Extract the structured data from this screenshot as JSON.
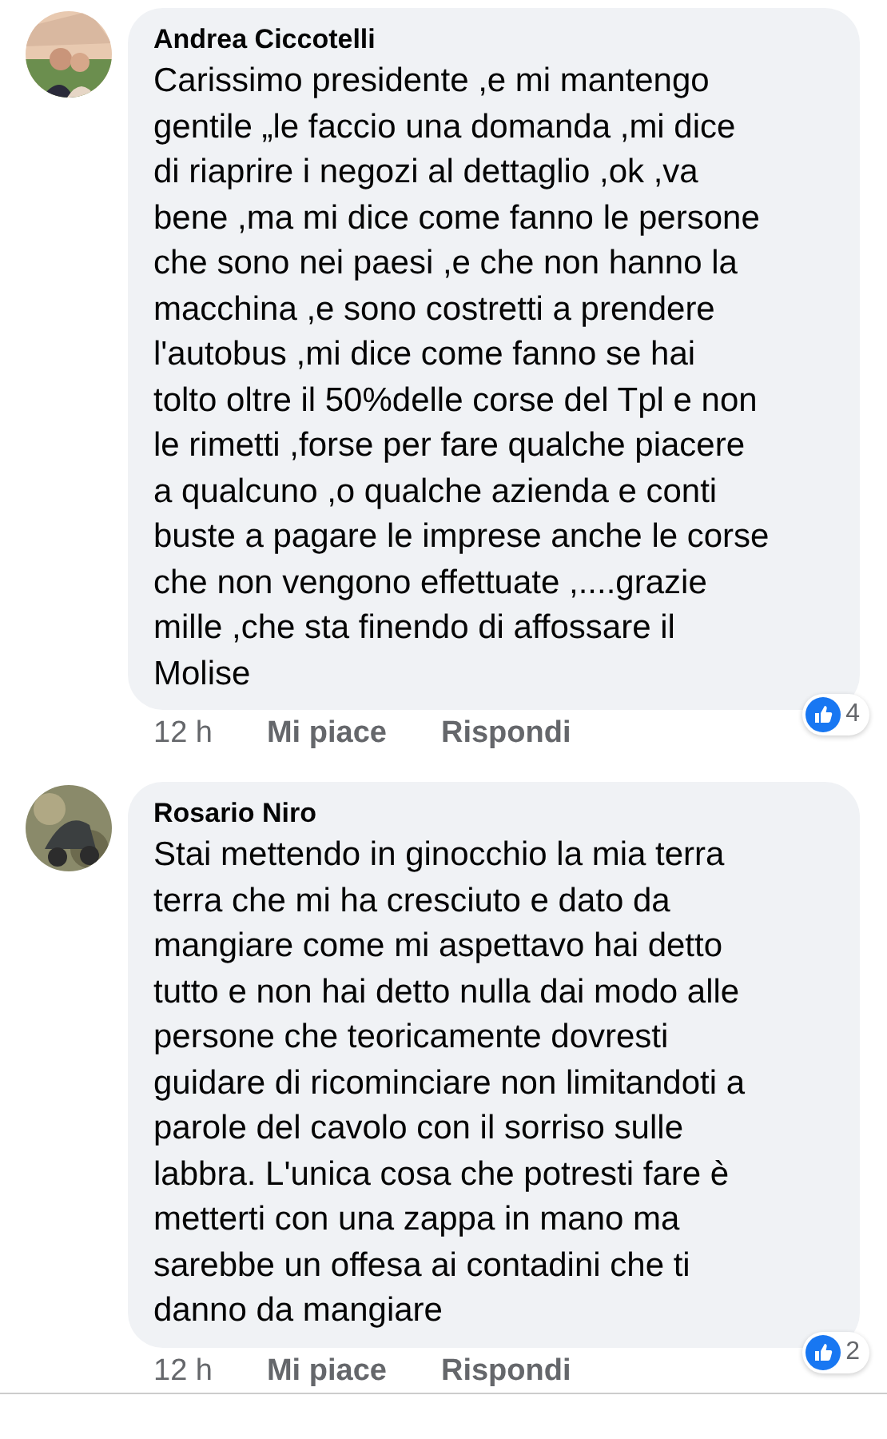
{
  "comments": [
    {
      "author": "Andrea Ciccotelli",
      "text": "Carissimo presidente ,e mi mantengo\ngentile „le faccio una domanda ,mi dice\ndi riaprire i negozi al dettaglio ,ok ,va\nbene ,ma mi dice come fanno le persone\nche sono nei paesi ,e che non hanno la\nmacchina ,e sono costretti a prendere\nl'autobus ,mi dice come fanno se hai\ntolto oltre il 50%delle corse del Tpl e non\nle rimetti ,forse per fare qualche piacere\na qualcuno ,o qualche azienda e conti\nbuste a pagare le imprese anche le corse\nche non vengono effettuate ,....grazie\nmille ,che sta finendo di affossare il\nMolise",
      "time": "12 h",
      "like": "Mi piace",
      "reply": "Rispondi",
      "reactions": "4"
    },
    {
      "author": "Rosario Niro",
      "text": "Stai mettendo in ginocchio la mia terra\nterra che mi ha cresciuto e dato da\nmangiare come mi aspettavo hai detto\ntutto e non hai detto nulla dai modo alle\npersone che teoricamente dovresti\nguidare di ricominciare non limitandoti a\nparole del cavolo con il sorriso sulle\nlabbra. L'unica cosa che potresti fare è\nmetterti con una zappa in mano ma\nsarebbe un offesa ai contadini che ti\ndanno da mangiare",
      "time": "12 h",
      "like": "Mi piace",
      "reply": "Rispondi",
      "reactions": "2"
    }
  ]
}
